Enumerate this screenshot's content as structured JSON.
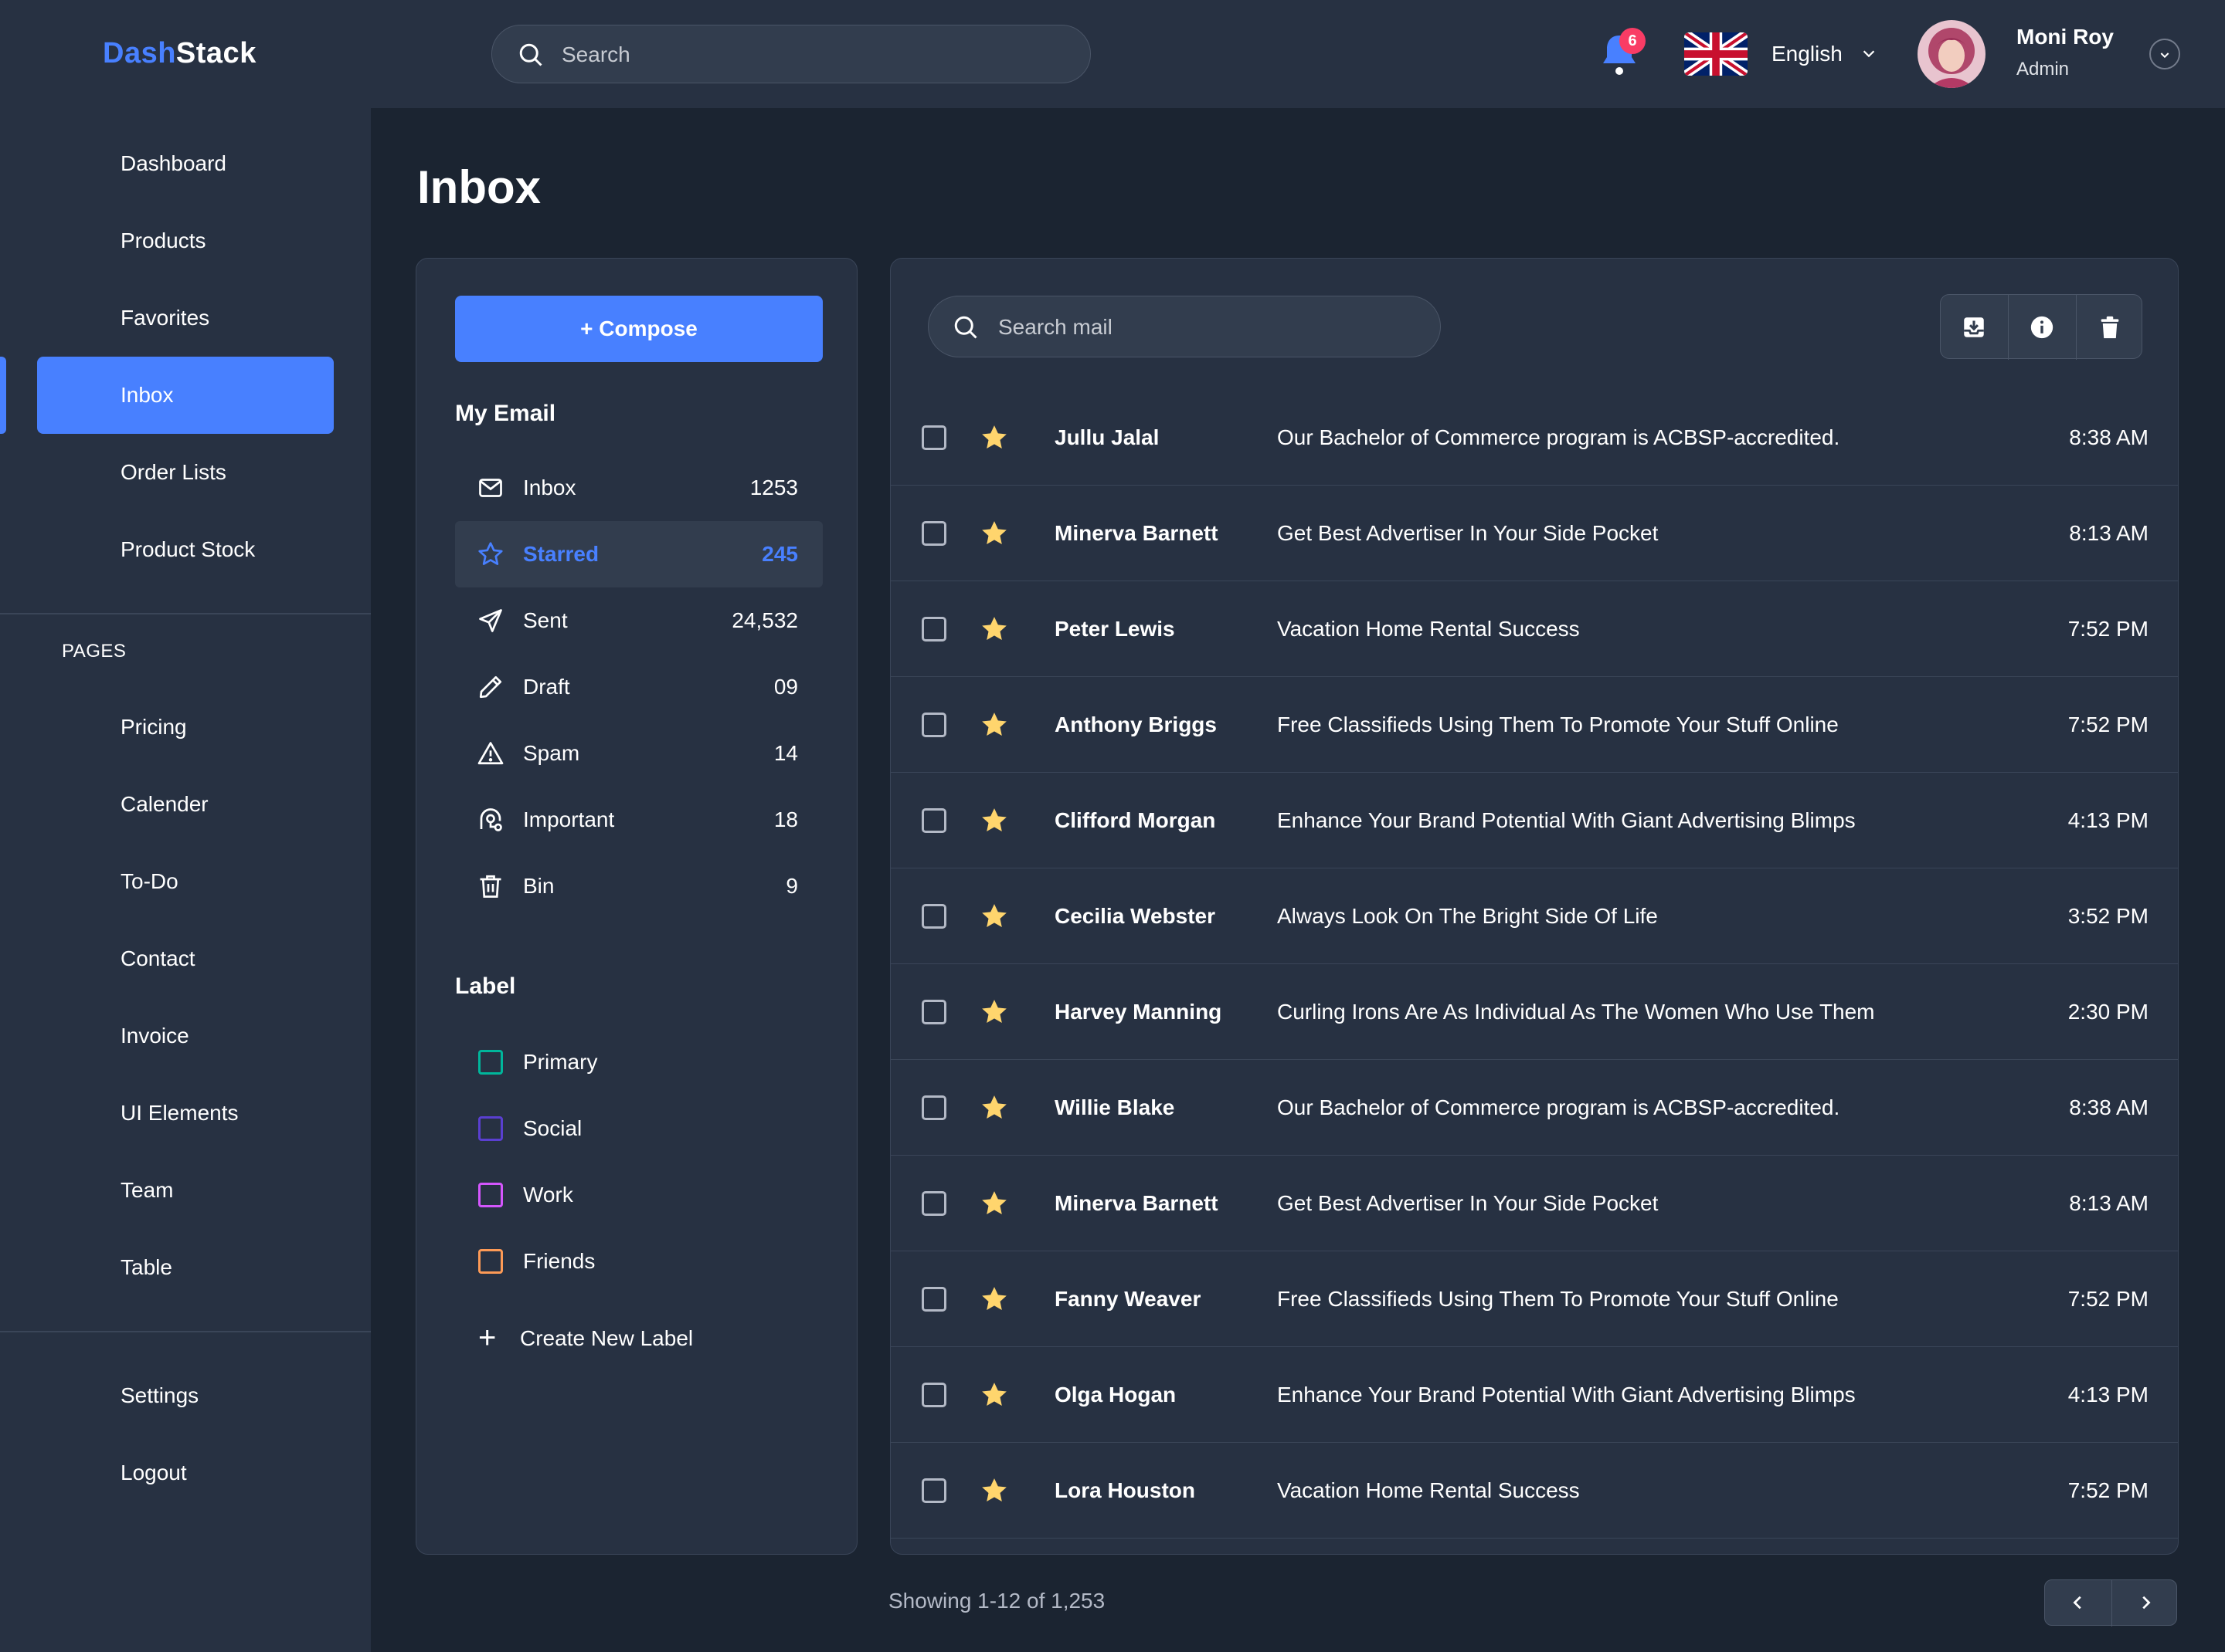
{
  "brand": {
    "part1": "Dash",
    "part2": "Stack"
  },
  "header": {
    "search_placeholder": "Search",
    "notification_count": "6",
    "language": "English",
    "user_name": "Moni Roy",
    "user_role": "Admin"
  },
  "sidebar": {
    "main_items": [
      {
        "label": "Dashboard"
      },
      {
        "label": "Products"
      },
      {
        "label": "Favorites"
      },
      {
        "label": "Inbox"
      },
      {
        "label": "Order Lists"
      },
      {
        "label": "Product Stock"
      }
    ],
    "pages_title": "PAGES",
    "page_items": [
      {
        "label": "Pricing"
      },
      {
        "label": "Calender"
      },
      {
        "label": "To-Do"
      },
      {
        "label": "Contact"
      },
      {
        "label": "Invoice"
      },
      {
        "label": "UI Elements"
      },
      {
        "label": "Team"
      },
      {
        "label": "Table"
      }
    ],
    "bottom_items": [
      {
        "label": "Settings"
      },
      {
        "label": "Logout"
      }
    ]
  },
  "page": {
    "title": "Inbox"
  },
  "mailbox": {
    "compose_label": "+ Compose",
    "my_email_title": "My Email",
    "folders": [
      {
        "label": "Inbox",
        "count": "1253",
        "icon": "envelope-icon"
      },
      {
        "label": "Starred",
        "count": "245",
        "icon": "star-icon"
      },
      {
        "label": "Sent",
        "count": "24,532",
        "icon": "send-icon"
      },
      {
        "label": "Draft",
        "count": "09",
        "icon": "pencil-icon"
      },
      {
        "label": "Spam",
        "count": "14",
        "icon": "warning-icon"
      },
      {
        "label": "Important",
        "count": "18",
        "icon": "important-icon"
      },
      {
        "label": "Bin",
        "count": "9",
        "icon": "trash-icon"
      }
    ],
    "label_title": "Label",
    "labels": [
      {
        "label": "Primary",
        "color": "#00b69b"
      },
      {
        "label": "Social",
        "color": "#5a3fd0"
      },
      {
        "label": "Work",
        "color": "#d456fd"
      },
      {
        "label": "Friends",
        "color": "#fd9a56"
      }
    ],
    "create_label": "Create New Label"
  },
  "mail_list": {
    "search_placeholder": "Search mail",
    "rows": [
      {
        "sender": "Jullu Jalal",
        "subject": "Our Bachelor of Commerce program is ACBSP-accredited.",
        "time": "8:38 AM"
      },
      {
        "sender": "Minerva Barnett",
        "subject": "Get Best Advertiser In Your Side Pocket",
        "time": "8:13 AM"
      },
      {
        "sender": "Peter Lewis",
        "subject": "Vacation Home Rental Success",
        "time": "7:52 PM"
      },
      {
        "sender": "Anthony Briggs",
        "subject": "Free Classifieds Using Them To Promote Your Stuff Online",
        "time": "7:52 PM"
      },
      {
        "sender": "Clifford Morgan",
        "subject": "Enhance Your Brand Potential With Giant Advertising Blimps",
        "time": "4:13 PM"
      },
      {
        "sender": "Cecilia Webster",
        "subject": "Always Look On The Bright Side Of Life",
        "time": "3:52 PM"
      },
      {
        "sender": "Harvey Manning",
        "subject": "Curling Irons Are As Individual As The Women Who Use Them",
        "time": "2:30 PM"
      },
      {
        "sender": "Willie Blake",
        "subject": "Our Bachelor of Commerce program is ACBSP-accredited.",
        "time": "8:38 AM"
      },
      {
        "sender": "Minerva Barnett",
        "subject": "Get Best Advertiser In Your Side Pocket",
        "time": "8:13 AM"
      },
      {
        "sender": "Fanny Weaver",
        "subject": "Free Classifieds Using Them To Promote Your Stuff Online",
        "time": "7:52 PM"
      },
      {
        "sender": "Olga Hogan",
        "subject": "Enhance Your Brand Potential With Giant Advertising Blimps",
        "time": "4:13 PM"
      },
      {
        "sender": "Lora Houston",
        "subject": "Vacation Home Rental Success",
        "time": "7:52 PM"
      }
    ],
    "showing": "Showing 1-12 of 1,253"
  },
  "colors": {
    "accent": "#4880ff",
    "background": "#1b2431",
    "panel": "#273142",
    "star": "#ffd56d",
    "badge": "#f93c65"
  }
}
